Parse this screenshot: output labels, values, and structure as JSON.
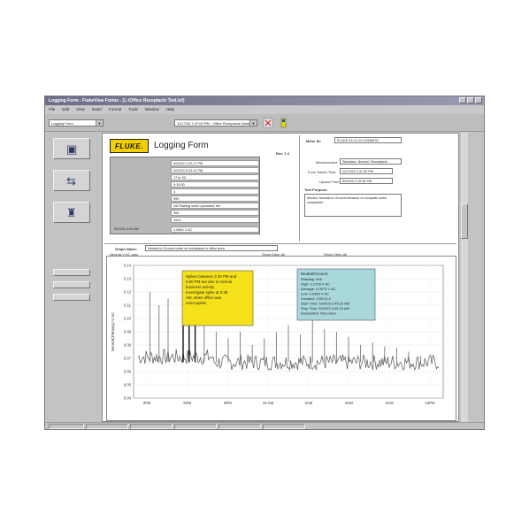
{
  "window": {
    "title": "Logging Form - FlukeView Forms - [L:\\Office Receptacle Test.lsf]"
  },
  "menubar": {
    "items": [
      "File",
      "Edit",
      "View",
      "Insert",
      "Format",
      "Tools",
      "Window",
      "Help"
    ]
  },
  "toolbar": {
    "form_select": "Logging Form",
    "session_select": "11/17/04 1:47:00 PM - Office Receptacle Noise"
  },
  "form": {
    "brand": "FLUKE.",
    "title": "Logging Form",
    "rev_label": "Rev. 1.4",
    "meter_id_label": "Meter ID:",
    "meter_id_value": "FLUKE 43   V1.20   12345678",
    "measurement_label": "Measurement",
    "measurement_value": "Standard, Neutral, Receptacle",
    "form_saved_label": "Form Saved Time",
    "form_saved_value": "11/17/04 1:47:00 PM",
    "upload_label": "Upload Time",
    "upload_value": "5/23/03 2:10:34 PM",
    "test_purpose_label": "Test Purpose:",
    "test_purpose_value": "Monitor Neutral to Ground because of computer locks complaints",
    "graph_name_label": "Graph Name:",
    "graph_name_value": "Neutral to Ground noise on receptacle in office area",
    "graph_sub_left": "Neutral-V AC auto",
    "graph_sub_mid": "Show Data: All",
    "graph_sub_right": "Show View: All"
  },
  "info_rows": [
    "5/23/03 1:22:17 PM",
    "5/23/03 6:13:12 PM",
    "17 hr 00",
    "0:10:00",
    "4",
    "999",
    "NA   Starting when uploaded: the",
    "306",
    "none"
  ],
  "info_bottom": {
    "left": "5/17/04 4:41 AM",
    "right": "0.0680 V AC"
  },
  "annotations": {
    "yellow": "Spikes between 2:30 PM and 5:00 PM are due to normal business activity.  Investigate spike at 3:45 AM, when office was unoccupied.",
    "cyan_title": "Neutral/Ground",
    "cyan_lines": [
      "Reading: 546",
      "High:  0.1378 V AC",
      "Average:  0.0673 V AC",
      "Low:  0.0360 V AC",
      "Duration:  0:00:01:0",
      "Start Time:  5/24/03 3:45:22 AM",
      "Stop Time:  5/24/03 3:45:23 AM",
      "Description:  Recorded"
    ]
  },
  "chart_data": {
    "type": "line",
    "ylabel": "Neutral(Primary)  V AC",
    "y_ticks": [
      "0.14",
      "0.13",
      "0.12",
      "0.11",
      "0.10",
      "0.09",
      "0.08",
      "0.07",
      "0.06",
      "0.05",
      "0.04"
    ],
    "ylim": [
      0.04,
      0.14
    ],
    "x_ticks": [
      "2PM",
      "5PM",
      "8PM",
      "24 Sat",
      "3AM",
      "6AM",
      "9AM",
      "12PM"
    ],
    "baseline": 0.067,
    "spikes": [
      {
        "x": 0.04,
        "y": 0.12
      },
      {
        "x": 0.07,
        "y": 0.11
      },
      {
        "x": 0.1,
        "y": 0.115
      },
      {
        "x": 0.15,
        "y": 0.128
      },
      {
        "x": 0.17,
        "y": 0.125
      },
      {
        "x": 0.19,
        "y": 0.12
      },
      {
        "x": 0.22,
        "y": 0.1
      },
      {
        "x": 0.26,
        "y": 0.09
      },
      {
        "x": 0.3,
        "y": 0.085
      },
      {
        "x": 0.34,
        "y": 0.09
      },
      {
        "x": 0.38,
        "y": 0.08
      },
      {
        "x": 0.42,
        "y": 0.085
      },
      {
        "x": 0.46,
        "y": 0.09
      },
      {
        "x": 0.5,
        "y": 0.095
      },
      {
        "x": 0.54,
        "y": 0.088
      },
      {
        "x": 0.58,
        "y": 0.1
      },
      {
        "x": 0.62,
        "y": 0.092
      },
      {
        "x": 0.66,
        "y": 0.09
      },
      {
        "x": 0.7,
        "y": 0.086
      },
      {
        "x": 0.74,
        "y": 0.08
      },
      {
        "x": 0.78,
        "y": 0.082
      },
      {
        "x": 0.82,
        "y": 0.079
      },
      {
        "x": 0.86,
        "y": 0.078
      },
      {
        "x": 0.9,
        "y": 0.075
      },
      {
        "x": 0.94,
        "y": 0.072
      }
    ],
    "grid": true
  },
  "status": {
    "cells": [
      "",
      "",
      "",
      "",
      "",
      ""
    ]
  },
  "colors": {
    "annotation_yellow": "#f5e11a",
    "annotation_cyan": "#a9d8dc",
    "fluke_yellow": "#f2cf00"
  }
}
